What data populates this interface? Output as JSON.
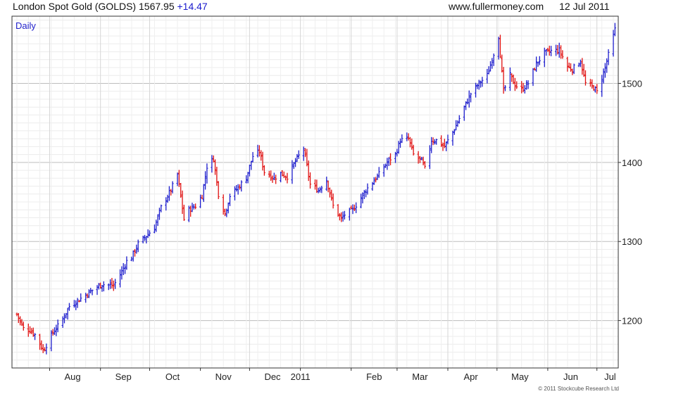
{
  "header": {
    "instrument": "London Spot Gold (GOLDS)",
    "price": "1567.95",
    "change": "+14.47",
    "website": "www.fullermoney.com",
    "date": "12 Jul 2011"
  },
  "footer": {
    "copyright": "© 2011 Stockcube Research Ltd"
  },
  "colors": {
    "up": "#1c1ccc",
    "down": "#e01010",
    "grid": "#d0d0d0",
    "frame": "#333333"
  },
  "chart_data": {
    "type": "ohlc",
    "period_label": "Daily",
    "y_axis": {
      "position": "right",
      "range": [
        1140,
        1585
      ],
      "ticks": [
        1200,
        1300,
        1400,
        1500
      ]
    },
    "x_axis": {
      "tick_labels": [
        "Aug",
        "Sep",
        "Oct",
        "Nov",
        "Dec",
        "2011",
        "Feb",
        "Mar",
        "Apr",
        "May",
        "Jun",
        "Jul"
      ]
    },
    "grid": true,
    "series": [
      {
        "price_path": {
          "x": [
            "2010-07-12",
            "2010-07-16",
            "2010-07-20",
            "2010-07-23",
            "2010-07-28",
            "2010-07-29",
            "2010-08-03",
            "2010-08-08",
            "2010-08-13",
            "2010-08-20",
            "2010-08-26",
            "2010-09-02",
            "2010-09-09",
            "2010-09-14",
            "2010-09-17",
            "2010-09-20",
            "2010-09-24",
            "2010-09-29",
            "2010-10-04",
            "2010-10-08",
            "2010-10-14",
            "2010-10-18",
            "2010-10-22",
            "2010-10-25",
            "2010-10-29",
            "2010-11-02",
            "2010-11-05",
            "2010-11-09",
            "2010-11-12",
            "2010-11-16",
            "2010-11-19",
            "2010-11-24",
            "2010-11-29",
            "2010-12-03",
            "2010-12-07",
            "2010-12-10",
            "2010-12-16",
            "2010-12-20",
            "2010-12-24",
            "2010-12-30",
            "2011-01-03",
            "2011-01-07",
            "2011-01-12",
            "2011-01-17",
            "2011-01-21",
            "2011-01-26",
            "2011-01-28",
            "2011-02-02",
            "2011-02-10",
            "2011-02-18",
            "2011-02-24",
            "2011-02-28",
            "2011-03-03",
            "2011-03-08",
            "2011-03-11",
            "2011-03-16",
            "2011-03-18",
            "2011-03-22",
            "2011-03-25",
            "2011-03-30",
            "2011-04-05",
            "2011-04-10",
            "2011-04-15",
            "2011-04-20",
            "2011-04-25",
            "2011-04-28",
            "2011-05-02",
            "2011-05-05",
            "2011-05-09",
            "2011-05-12",
            "2011-05-16",
            "2011-05-20",
            "2011-05-25",
            "2011-05-30",
            "2011-06-03",
            "2011-06-08",
            "2011-06-13",
            "2011-06-16",
            "2011-06-21",
            "2011-06-24",
            "2011-06-29",
            "2011-07-01",
            "2011-07-06",
            "2011-07-12"
          ],
          "close": [
            1208,
            1190,
            1188,
            1182,
            1163,
            1165,
            1185,
            1198,
            1218,
            1228,
            1237,
            1246,
            1244,
            1262,
            1275,
            1280,
            1297,
            1307,
            1318,
            1343,
            1365,
            1385,
            1328,
            1340,
            1345,
            1358,
            1395,
            1405,
            1360,
            1335,
            1358,
            1368,
            1381,
            1408,
            1414,
            1388,
            1380,
            1386,
            1382,
            1405,
            1418,
            1372,
            1365,
            1378,
            1345,
            1328,
            1334,
            1340,
            1365,
            1385,
            1403,
            1410,
            1428,
            1430,
            1410,
            1402,
            1392,
            1428,
            1428,
            1420,
            1442,
            1465,
            1487,
            1500,
            1510,
            1530,
            1560,
            1490,
            1510,
            1498,
            1492,
            1500,
            1525,
            1538,
            1541,
            1542,
            1521,
            1518,
            1528,
            1500,
            1495,
            1489,
            1520,
            1568
          ]
        }
      }
    ],
    "annotations": [
      "Daily"
    ]
  }
}
